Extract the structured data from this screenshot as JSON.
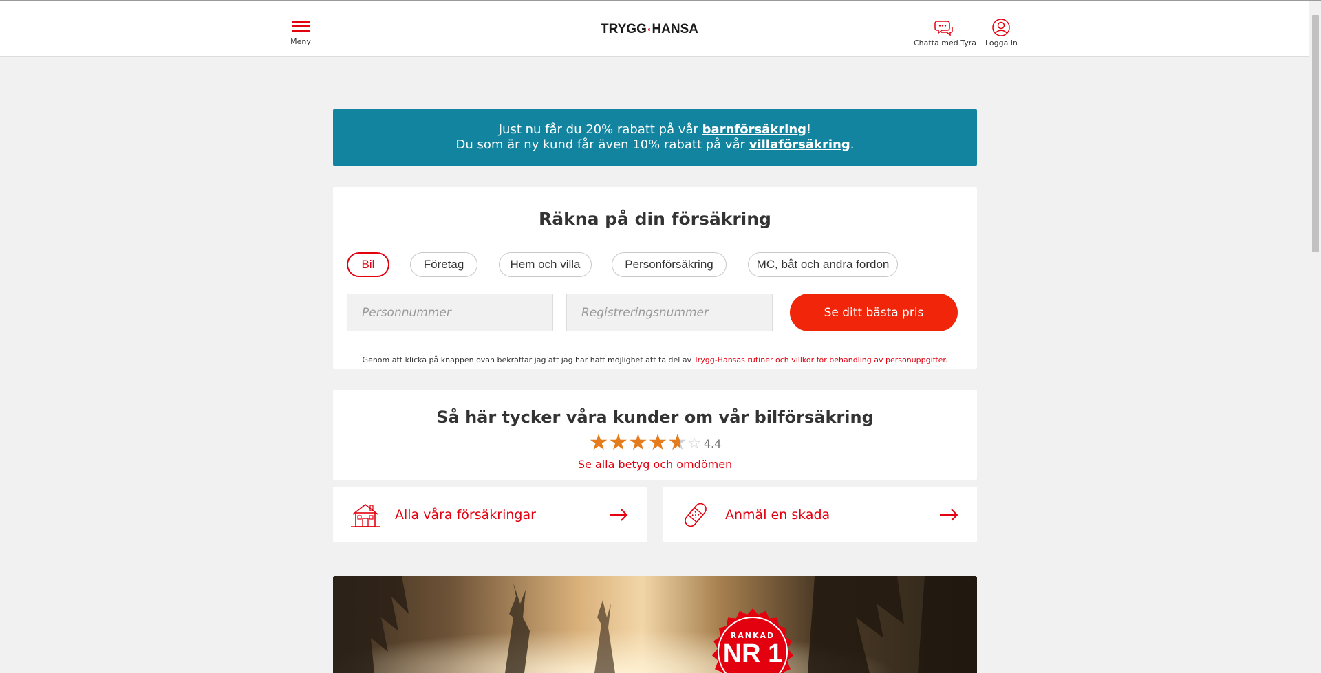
{
  "header": {
    "menu_label": "Meny",
    "logo_left": "TRYGG",
    "logo_right": "HANSA",
    "chat_label": "Chatta med Tyra",
    "login_label": "Logga in",
    "brand_color": "#e3000f"
  },
  "banner": {
    "line1_prefix": "Just nu får du 20% rabatt på vår ",
    "line1_link": "barnförsäkring",
    "line1_suffix": "!",
    "line2_prefix": "Du som är ny kund får även 10% rabatt på vår ",
    "line2_link": "villaförsäkring",
    "line2_suffix": ".",
    "color": "#12849f"
  },
  "calculator": {
    "title": "Räkna på din försäkring",
    "tabs": [
      {
        "label": "Bil",
        "active": true
      },
      {
        "label": "Företag",
        "active": false
      },
      {
        "label": "Hem och villa",
        "active": false
      },
      {
        "label": "Personförsäkring",
        "active": false
      },
      {
        "label": "MC, båt och andra fordon",
        "active": false
      }
    ],
    "personnummer_placeholder": "Personnummer",
    "regnr_placeholder": "Registreringsnummer",
    "cta_label": "Se ditt bästa pris",
    "disclaimer_text": "Genom att klicka på knappen ovan bekräftar jag att jag har haft möjlighet att ta del av ",
    "disclaimer_link": "Trygg-Hansas rutiner och villkor för behandling av personuppgifter."
  },
  "rating": {
    "title": "Så här tycker våra kunder om vår bilförsäkring",
    "value": "4.4",
    "stars": 4.4,
    "link": "Se alla betyg och omdömen"
  },
  "links": [
    {
      "label": "Alla våra försäkringar",
      "icon": "house-icon"
    },
    {
      "label": "Anmäl en skada",
      "icon": "bandage-icon"
    }
  ],
  "hero": {
    "badge_top": "RANKAD",
    "badge_main": "NR 1"
  }
}
